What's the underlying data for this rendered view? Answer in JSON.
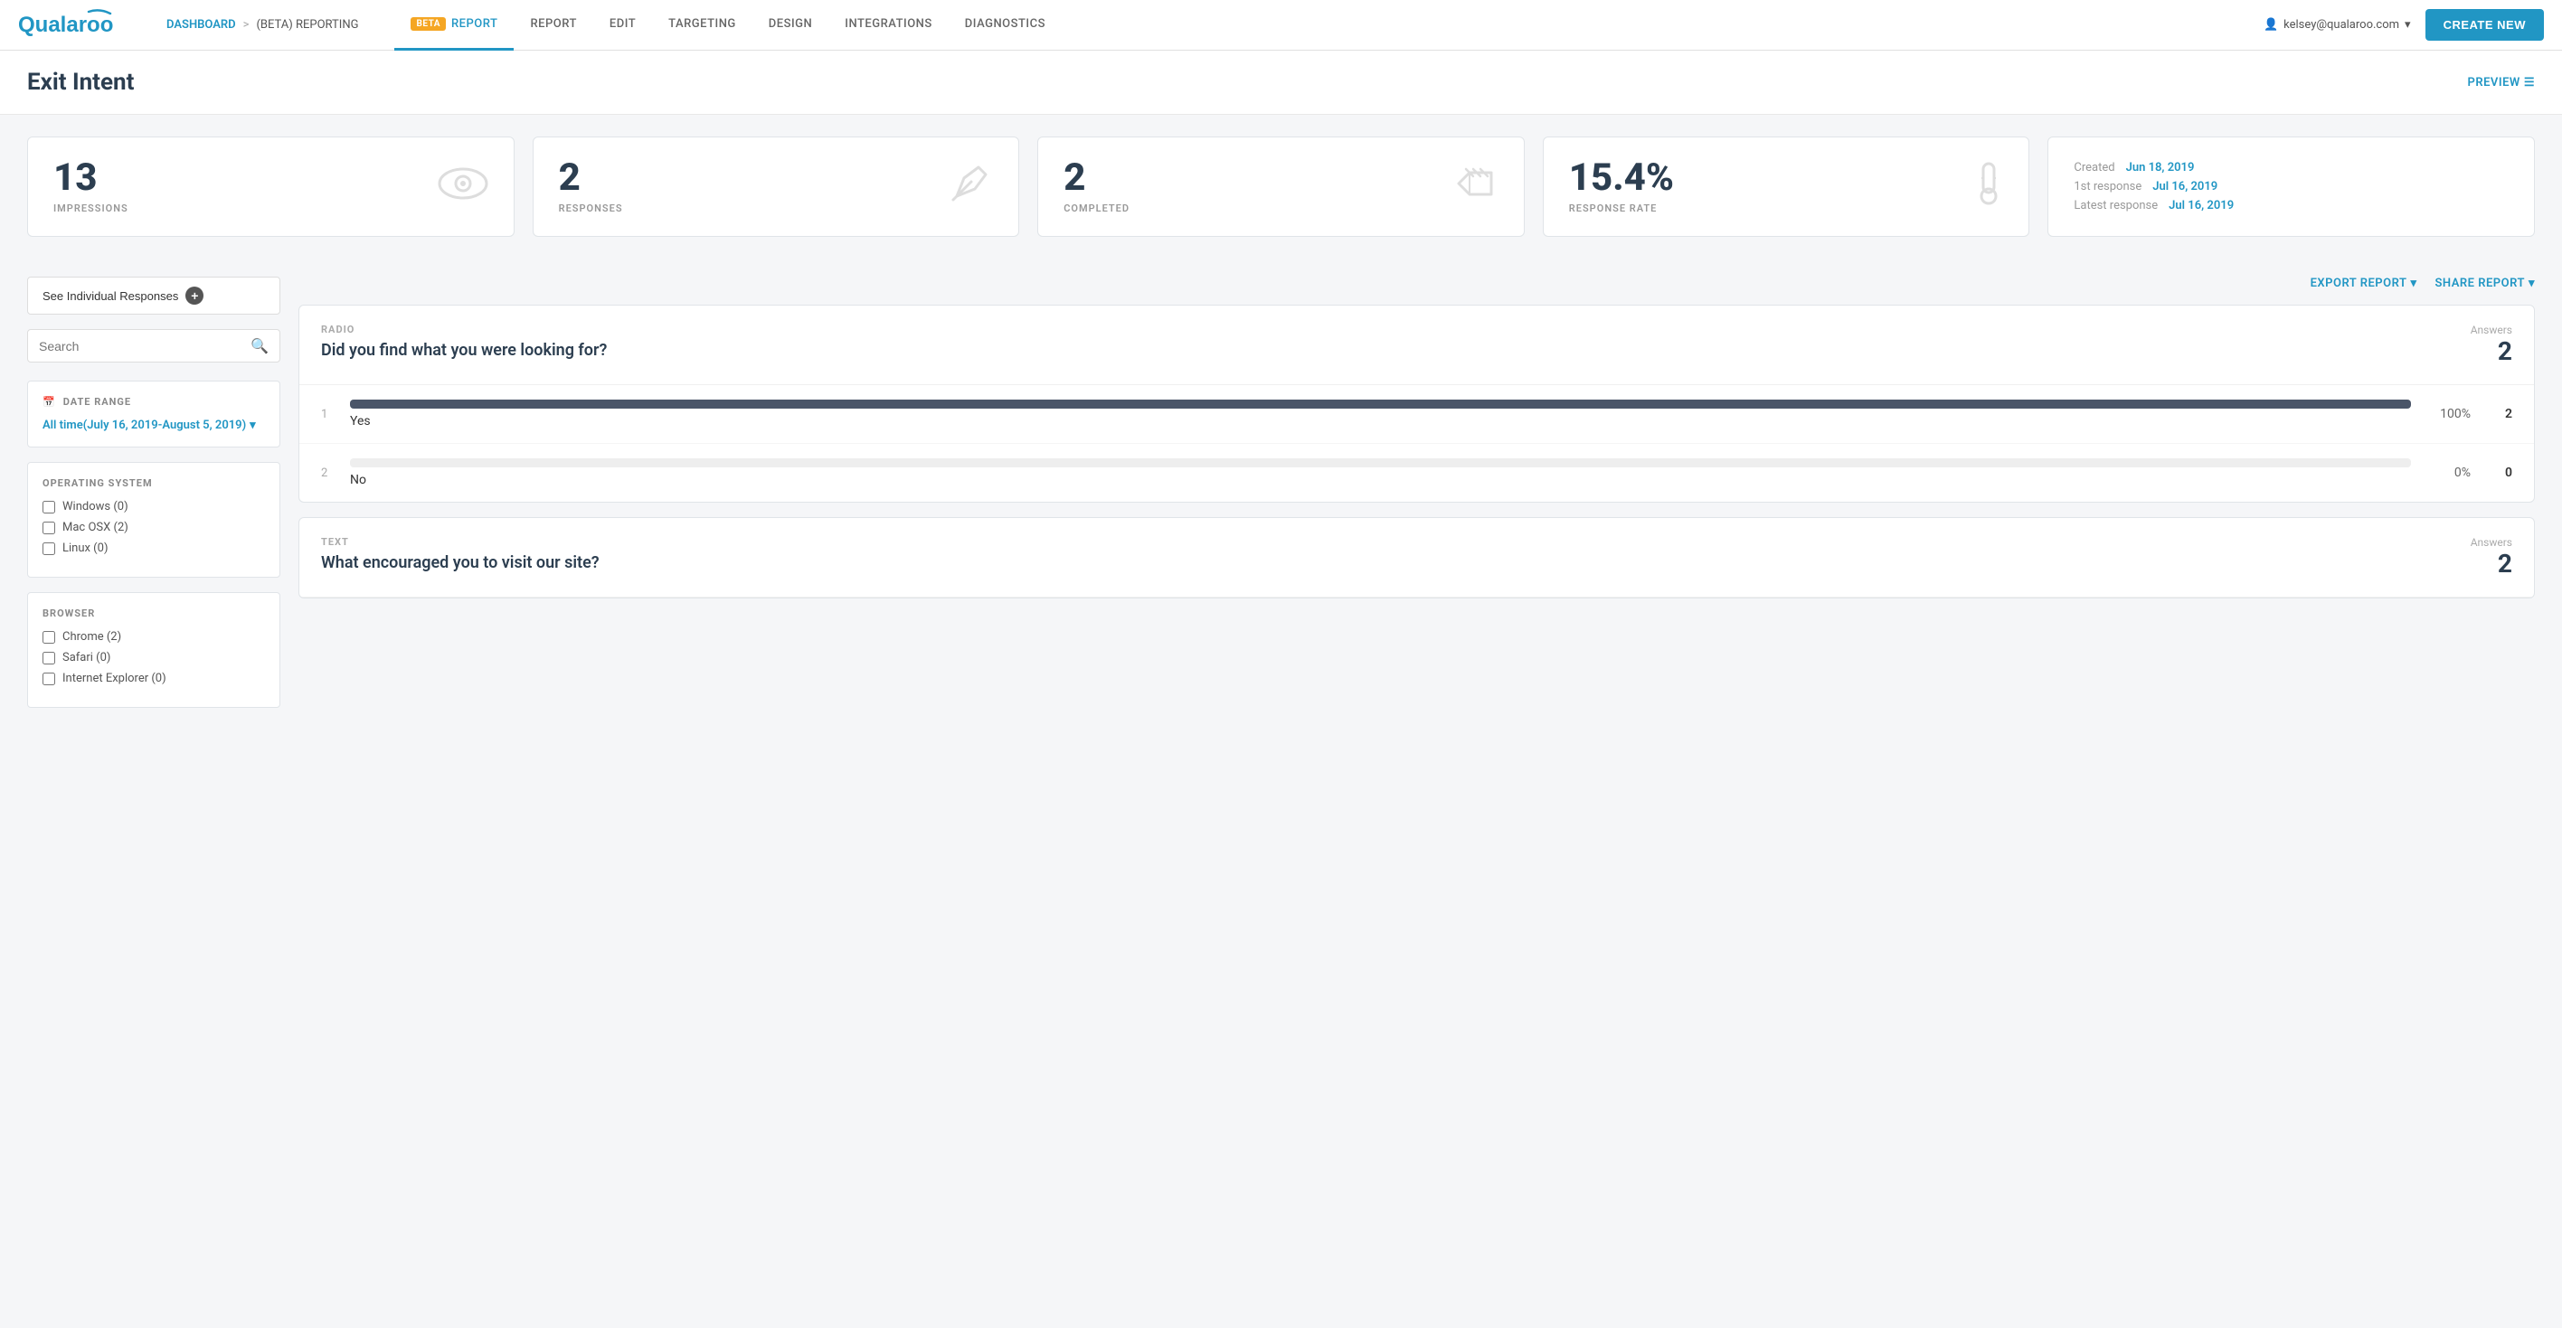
{
  "logo": {
    "text": "Qualaroo"
  },
  "nav": {
    "breadcrumb": {
      "dashboard": "DASHBOARD",
      "separator": ">",
      "current": "(BETA) REPORTING"
    },
    "tabs": [
      {
        "id": "beta-report",
        "label": "REPORT",
        "badge": "BETA",
        "active": true
      },
      {
        "id": "report",
        "label": "REPORT",
        "active": false
      },
      {
        "id": "edit",
        "label": "EDIT",
        "active": false
      },
      {
        "id": "targeting",
        "label": "TARGETING",
        "active": false
      },
      {
        "id": "design",
        "label": "DESIGN",
        "active": false
      },
      {
        "id": "integrations",
        "label": "INTEGRATIONS",
        "active": false
      },
      {
        "id": "diagnostics",
        "label": "DIAGNOSTICS",
        "active": false
      }
    ],
    "user": "kelsey@qualaroo.com",
    "create_btn": "CREATE NEW"
  },
  "page": {
    "title": "Exit Intent",
    "preview_label": "PREVIEW"
  },
  "stats": [
    {
      "number": "13",
      "label": "IMPRESSIONS",
      "icon": "👁"
    },
    {
      "number": "2",
      "label": "RESPONSES",
      "icon": "✏️"
    },
    {
      "number": "2",
      "label": "COMPLETED",
      "icon": "🏁"
    },
    {
      "number": "15.4%",
      "label": "RESPONSE RATE",
      "icon": "🌡"
    }
  ],
  "dates": {
    "created_label": "Created",
    "created_value": "Jun 18, 2019",
    "first_label": "1st response",
    "first_value": "Jul 16, 2019",
    "latest_label": "Latest response",
    "latest_value": "Jul 16, 2019"
  },
  "sidebar": {
    "see_individual_btn": "See Individual Responses",
    "search_placeholder": "Search",
    "date_range_title": "DATE RANGE",
    "date_range_value": "All time(July 16, 2019-August 5, 2019)",
    "operating_system_title": "OPERATING SYSTEM",
    "os_options": [
      {
        "label": "Windows (0)",
        "checked": false
      },
      {
        "label": "Mac OSX (2)",
        "checked": false
      },
      {
        "label": "Linux (0)",
        "checked": false
      }
    ],
    "browser_title": "BROWSER",
    "browser_options": [
      {
        "label": "Chrome (2)",
        "checked": false
      },
      {
        "label": "Safari (0)",
        "checked": false
      },
      {
        "label": "Internet Explorer (0)",
        "checked": false
      }
    ]
  },
  "report": {
    "export_btn": "EXPORT REPORT",
    "share_btn": "SHARE REPORT",
    "questions": [
      {
        "type": "RADIO",
        "text": "Did you find what you were looking for?",
        "answers_label": "Answers",
        "answers_count": "2",
        "options": [
          {
            "num": "1",
            "text": "Yes",
            "pct": "100%",
            "pct_val": 100,
            "count": "2"
          },
          {
            "num": "2",
            "text": "No",
            "pct": "0%",
            "pct_val": 0,
            "count": "0"
          }
        ]
      },
      {
        "type": "TEXT",
        "text": "What encouraged you to visit our site?",
        "answers_label": "Answers",
        "answers_count": "2",
        "options": []
      }
    ]
  }
}
